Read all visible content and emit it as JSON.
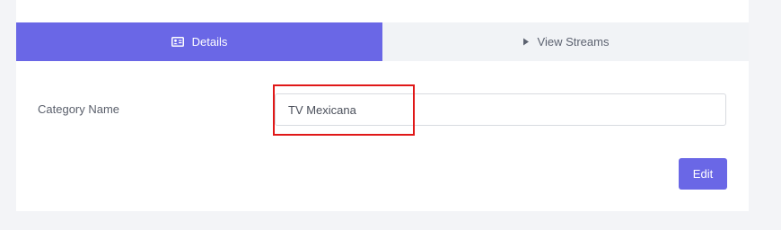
{
  "tabs": [
    {
      "label": "Details",
      "icon": "id-card-icon",
      "active": true
    },
    {
      "label": "View Streams",
      "icon": "play-icon",
      "active": false
    }
  ],
  "form": {
    "category_label": "Category Name",
    "category_value": "TV Mexicana"
  },
  "actions": {
    "edit_label": "Edit"
  },
  "colors": {
    "accent": "#6a67e6",
    "highlight": "#e01818",
    "inactive_tab": "#f1f3f6",
    "background": "#f3f4f7"
  }
}
